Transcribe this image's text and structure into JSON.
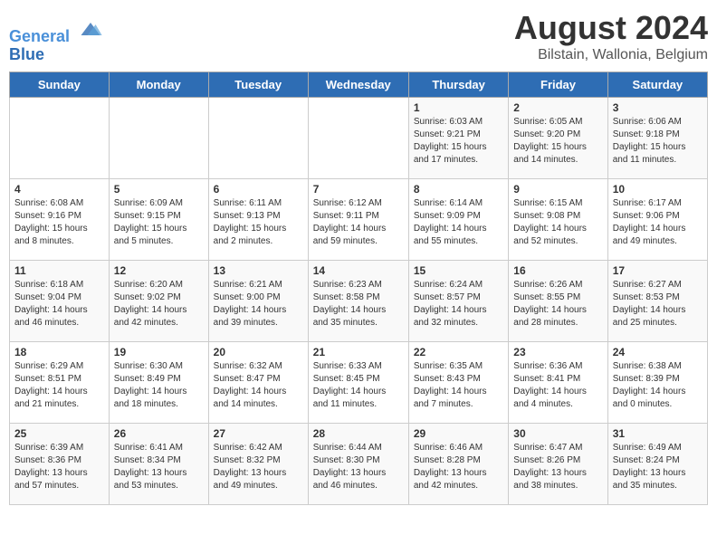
{
  "header": {
    "logo_line1": "General",
    "logo_line2": "Blue",
    "title": "August 2024",
    "subtitle": "Bilstain, Wallonia, Belgium"
  },
  "days_of_week": [
    "Sunday",
    "Monday",
    "Tuesday",
    "Wednesday",
    "Thursday",
    "Friday",
    "Saturday"
  ],
  "weeks": [
    [
      {
        "day": "",
        "info": ""
      },
      {
        "day": "",
        "info": ""
      },
      {
        "day": "",
        "info": ""
      },
      {
        "day": "",
        "info": ""
      },
      {
        "day": "1",
        "info": "Sunrise: 6:03 AM\nSunset: 9:21 PM\nDaylight: 15 hours\nand 17 minutes."
      },
      {
        "day": "2",
        "info": "Sunrise: 6:05 AM\nSunset: 9:20 PM\nDaylight: 15 hours\nand 14 minutes."
      },
      {
        "day": "3",
        "info": "Sunrise: 6:06 AM\nSunset: 9:18 PM\nDaylight: 15 hours\nand 11 minutes."
      }
    ],
    [
      {
        "day": "4",
        "info": "Sunrise: 6:08 AM\nSunset: 9:16 PM\nDaylight: 15 hours\nand 8 minutes."
      },
      {
        "day": "5",
        "info": "Sunrise: 6:09 AM\nSunset: 9:15 PM\nDaylight: 15 hours\nand 5 minutes."
      },
      {
        "day": "6",
        "info": "Sunrise: 6:11 AM\nSunset: 9:13 PM\nDaylight: 15 hours\nand 2 minutes."
      },
      {
        "day": "7",
        "info": "Sunrise: 6:12 AM\nSunset: 9:11 PM\nDaylight: 14 hours\nand 59 minutes."
      },
      {
        "day": "8",
        "info": "Sunrise: 6:14 AM\nSunset: 9:09 PM\nDaylight: 14 hours\nand 55 minutes."
      },
      {
        "day": "9",
        "info": "Sunrise: 6:15 AM\nSunset: 9:08 PM\nDaylight: 14 hours\nand 52 minutes."
      },
      {
        "day": "10",
        "info": "Sunrise: 6:17 AM\nSunset: 9:06 PM\nDaylight: 14 hours\nand 49 minutes."
      }
    ],
    [
      {
        "day": "11",
        "info": "Sunrise: 6:18 AM\nSunset: 9:04 PM\nDaylight: 14 hours\nand 46 minutes."
      },
      {
        "day": "12",
        "info": "Sunrise: 6:20 AM\nSunset: 9:02 PM\nDaylight: 14 hours\nand 42 minutes."
      },
      {
        "day": "13",
        "info": "Sunrise: 6:21 AM\nSunset: 9:00 PM\nDaylight: 14 hours\nand 39 minutes."
      },
      {
        "day": "14",
        "info": "Sunrise: 6:23 AM\nSunset: 8:58 PM\nDaylight: 14 hours\nand 35 minutes."
      },
      {
        "day": "15",
        "info": "Sunrise: 6:24 AM\nSunset: 8:57 PM\nDaylight: 14 hours\nand 32 minutes."
      },
      {
        "day": "16",
        "info": "Sunrise: 6:26 AM\nSunset: 8:55 PM\nDaylight: 14 hours\nand 28 minutes."
      },
      {
        "day": "17",
        "info": "Sunrise: 6:27 AM\nSunset: 8:53 PM\nDaylight: 14 hours\nand 25 minutes."
      }
    ],
    [
      {
        "day": "18",
        "info": "Sunrise: 6:29 AM\nSunset: 8:51 PM\nDaylight: 14 hours\nand 21 minutes."
      },
      {
        "day": "19",
        "info": "Sunrise: 6:30 AM\nSunset: 8:49 PM\nDaylight: 14 hours\nand 18 minutes."
      },
      {
        "day": "20",
        "info": "Sunrise: 6:32 AM\nSunset: 8:47 PM\nDaylight: 14 hours\nand 14 minutes."
      },
      {
        "day": "21",
        "info": "Sunrise: 6:33 AM\nSunset: 8:45 PM\nDaylight: 14 hours\nand 11 minutes."
      },
      {
        "day": "22",
        "info": "Sunrise: 6:35 AM\nSunset: 8:43 PM\nDaylight: 14 hours\nand 7 minutes."
      },
      {
        "day": "23",
        "info": "Sunrise: 6:36 AM\nSunset: 8:41 PM\nDaylight: 14 hours\nand 4 minutes."
      },
      {
        "day": "24",
        "info": "Sunrise: 6:38 AM\nSunset: 8:39 PM\nDaylight: 14 hours\nand 0 minutes."
      }
    ],
    [
      {
        "day": "25",
        "info": "Sunrise: 6:39 AM\nSunset: 8:36 PM\nDaylight: 13 hours\nand 57 minutes."
      },
      {
        "day": "26",
        "info": "Sunrise: 6:41 AM\nSunset: 8:34 PM\nDaylight: 13 hours\nand 53 minutes."
      },
      {
        "day": "27",
        "info": "Sunrise: 6:42 AM\nSunset: 8:32 PM\nDaylight: 13 hours\nand 49 minutes."
      },
      {
        "day": "28",
        "info": "Sunrise: 6:44 AM\nSunset: 8:30 PM\nDaylight: 13 hours\nand 46 minutes."
      },
      {
        "day": "29",
        "info": "Sunrise: 6:46 AM\nSunset: 8:28 PM\nDaylight: 13 hours\nand 42 minutes."
      },
      {
        "day": "30",
        "info": "Sunrise: 6:47 AM\nSunset: 8:26 PM\nDaylight: 13 hours\nand 38 minutes."
      },
      {
        "day": "31",
        "info": "Sunrise: 6:49 AM\nSunset: 8:24 PM\nDaylight: 13 hours\nand 35 minutes."
      }
    ]
  ]
}
